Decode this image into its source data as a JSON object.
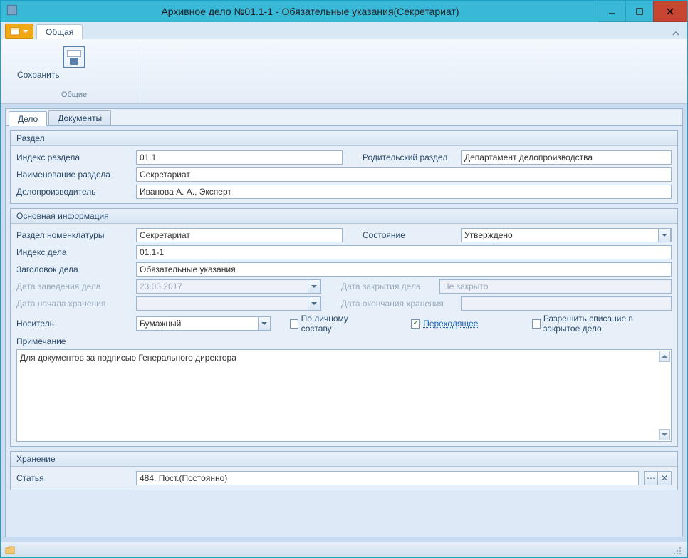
{
  "window": {
    "title": "Архивное дело №01.1-1 - Обязательные указания(Секретариат)"
  },
  "ribbon": {
    "tab_general": "Общая",
    "save_label": "Сохранить",
    "group_common": "Общие"
  },
  "tabs": {
    "case": "Дело",
    "documents": "Документы"
  },
  "section": {
    "title": "Раздел",
    "index_label": "Индекс раздела",
    "index_value": "01.1",
    "parent_label": "Родительский раздел",
    "parent_value": "Департамент делопроизводства",
    "name_label": "Наименование раздела",
    "name_value": "Секретариат",
    "clerk_label": "Делопроизводитель",
    "clerk_value": "Иванова А. А., Эксперт"
  },
  "main": {
    "title": "Основная информация",
    "nomen_label": "Раздел номенклатуры",
    "nomen_value": "Секретариат",
    "state_label": "Состояние",
    "state_value": "Утверждено",
    "case_index_label": "Индекс дела",
    "case_index_value": "01.1-1",
    "case_title_label": "Заголовок дела",
    "case_title_value": "Обязательные указания",
    "open_date_label": "Дата заведения дела",
    "open_date_value": "23.03.2017",
    "close_date_label": "Дата закрытия дела",
    "close_date_value": "Не закрыто",
    "store_start_label": "Дата начала хранения",
    "store_end_label": "Дата окончания хранения",
    "carrier_label": "Носитель",
    "carrier_value": "Бумажный",
    "personal_label": "По личному составу",
    "transitional_label": "Переходящее",
    "writeoff_label": "Разрешить списание в закрытое дело",
    "note_label": "Примечание",
    "note_value": "Для документов за подписью Генерального директора"
  },
  "storage": {
    "title": "Хранение",
    "article_label": "Статья",
    "article_value": "484. Пост.(Постоянно)"
  }
}
